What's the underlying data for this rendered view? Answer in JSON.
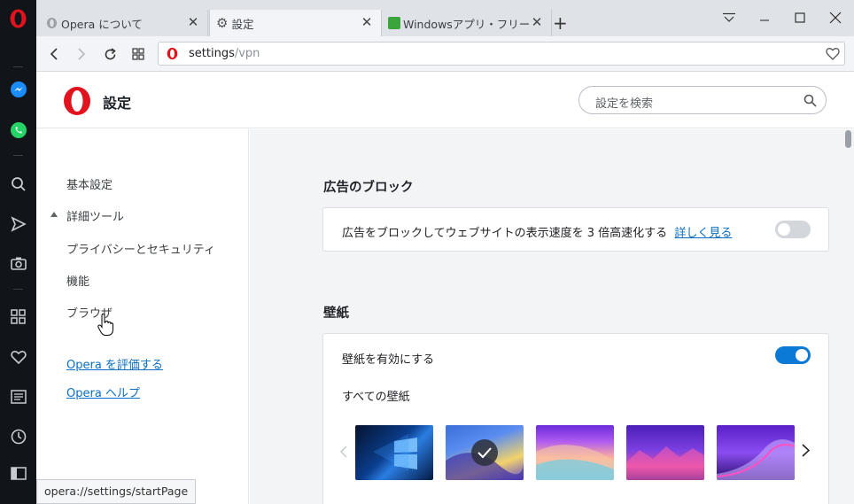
{
  "tabs": [
    {
      "title": "Opera について",
      "icon": "opera-icon",
      "active": false
    },
    {
      "title": "設定",
      "icon": "gear-icon",
      "active": true
    },
    {
      "title": "Windowsアプリ・フリーソフトの",
      "icon": "site-favicon",
      "active": false
    }
  ],
  "newtab_symbol": "+",
  "address": {
    "host": "settings",
    "path": "/vpn"
  },
  "header": {
    "title": "設定",
    "search_placeholder": "設定を検索"
  },
  "leftnav": {
    "basic": "基本設定",
    "advanced": "詳細ツール",
    "privacy": "プライバシーとセキュリティ",
    "features": "機能",
    "browser": "ブラウザ",
    "rate": "Opera を評価する",
    "help": "Opera ヘルプ"
  },
  "adblock": {
    "section_title": "広告のブロック",
    "description": "広告をブロックしてウェブサイトの表示速度を 3 倍高速化する",
    "learn_more": "詳しく見る",
    "enabled": false
  },
  "wallpaper": {
    "section_title": "壁紙",
    "enable_label": "壁紙を有効にする",
    "enabled": true,
    "all_label": "すべての壁紙",
    "items": [
      {
        "name": "windows-10-wallpaper",
        "selected": false
      },
      {
        "name": "blue-waves-wallpaper",
        "selected": true
      },
      {
        "name": "pastel-gradient-wallpaper",
        "selected": false
      },
      {
        "name": "purple-landscape-wallpaper",
        "selected": false
      },
      {
        "name": "violet-curve-wallpaper",
        "selected": false
      }
    ]
  },
  "statusbar": {
    "text": "opera://settings/startPage"
  },
  "colors": {
    "accent": "#0a7ad6",
    "link": "#0a6ec2",
    "opera_red": "#e0131e"
  }
}
